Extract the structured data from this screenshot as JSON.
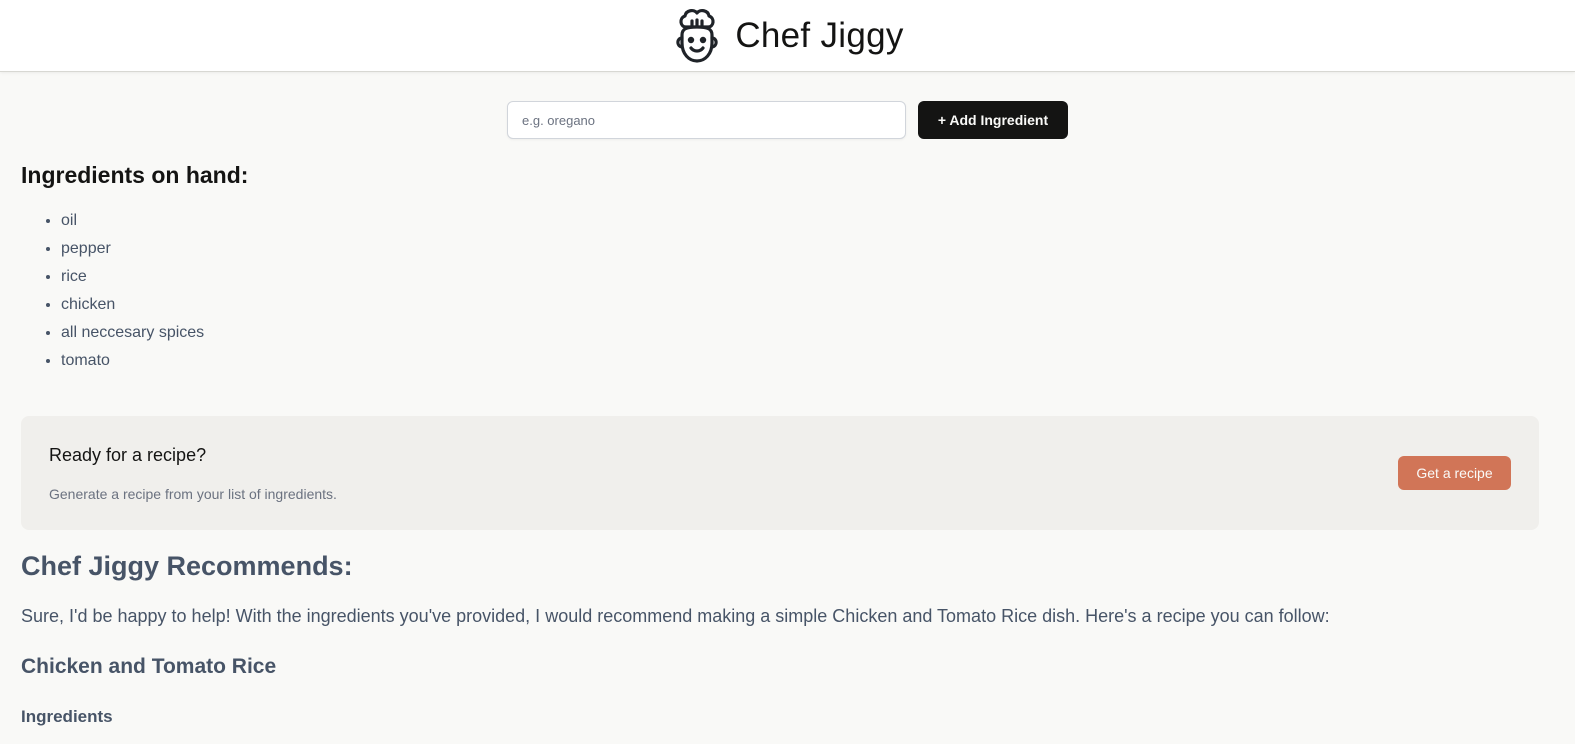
{
  "header": {
    "logo_icon": "chef-face-icon",
    "brand": "Chef Jiggy"
  },
  "form": {
    "placeholder": "e.g. oregano",
    "value": "",
    "add_button_label": "+ Add Ingredient"
  },
  "ingredients": {
    "title": "Ingredients on hand:",
    "items": [
      "oil",
      "pepper",
      "rice",
      "chicken",
      "all neccesary spices",
      "tomato"
    ]
  },
  "cta": {
    "title": "Ready for a recipe?",
    "subtitle": "Generate a recipe from your list of ingredients.",
    "button_label": "Get a recipe",
    "button_color": "#d17557"
  },
  "recommendation": {
    "title": "Chef Jiggy Recommends:",
    "intro": "Sure, I'd be happy to help! With the ingredients you've provided, I would recommend making a simple Chicken and Tomato Rice dish. Here's a recipe you can follow:",
    "recipe_name": "Chicken and Tomato Rice",
    "subhead": "Ingredients"
  },
  "colors": {
    "background": "#f9f9f7",
    "primary_button": "#141413",
    "accent": "#d17557",
    "text_muted": "#475467"
  }
}
